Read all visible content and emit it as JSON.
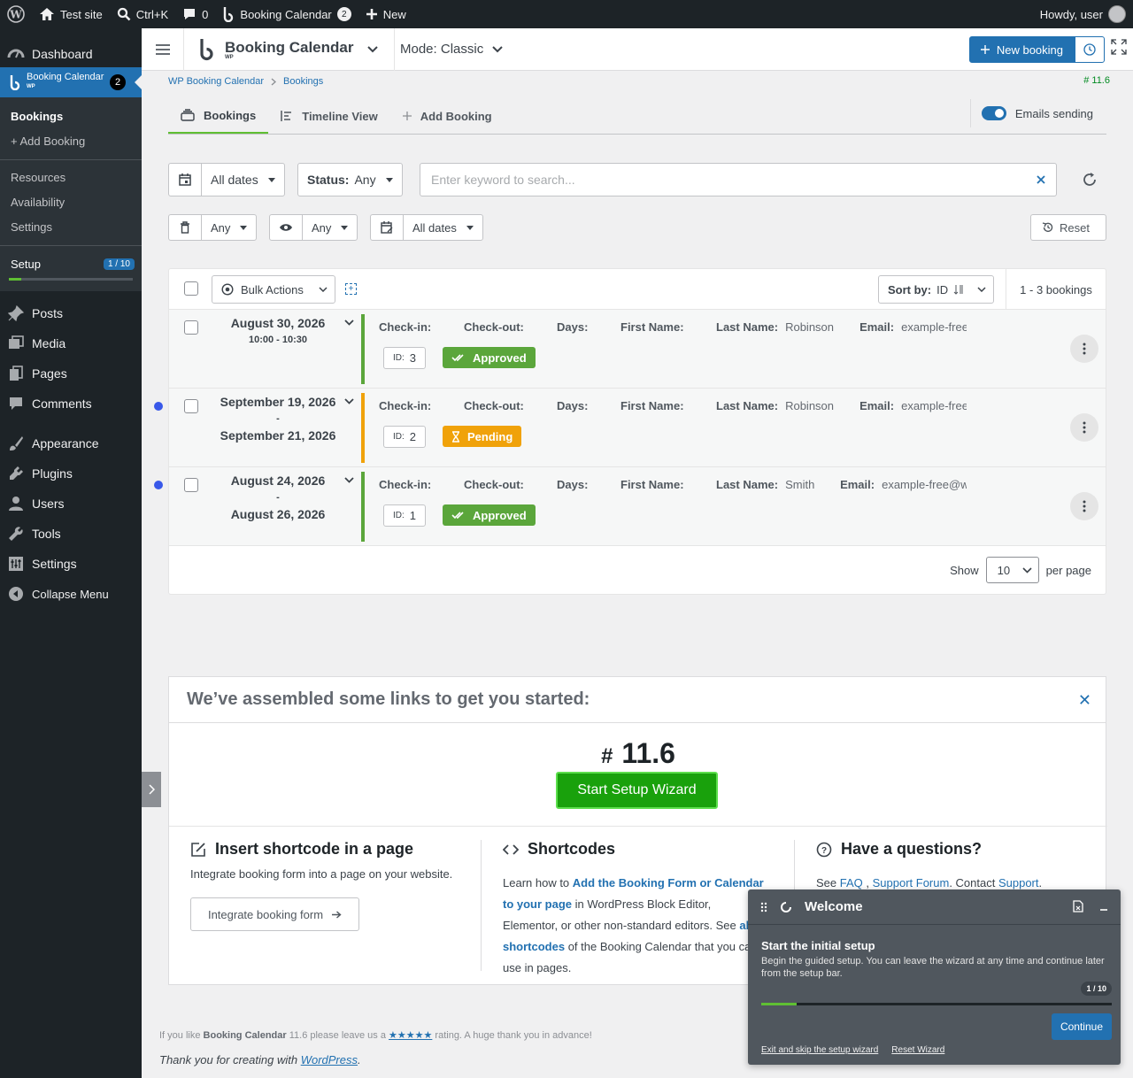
{
  "adminbar": {
    "site": "Test site",
    "search": "Ctrl+K",
    "comments": "0",
    "plugin": "Booking Calendar",
    "plugin_count": "2",
    "new": "New",
    "howdy": "Howdy, user"
  },
  "sidebar": {
    "dashboard": "Dashboard",
    "booking_calendar": "Booking Calendar",
    "booking_calendar_sub": "WP",
    "booking_count": "2",
    "sub": {
      "bookings": "Bookings",
      "add_booking": "+ Add Booking",
      "resources": "Resources",
      "availability": "Availability",
      "settings": "Settings",
      "setup": "Setup",
      "setup_step": "1 / 10",
      "setup_progress": 0.1
    },
    "items": {
      "posts": "Posts",
      "media": "Media",
      "pages": "Pages",
      "comments": "Comments",
      "appearance": "Appearance",
      "plugins": "Plugins",
      "users": "Users",
      "tools": "Tools",
      "settings": "Settings",
      "collapse": "Collapse Menu"
    }
  },
  "topbar": {
    "brand": "Booking Calendar",
    "brand_sub": "WP",
    "mode": "Mode: Classic",
    "new_booking": "New booking"
  },
  "breadcrumb": {
    "root": "WP Booking Calendar",
    "current": "Bookings",
    "version": "# 11.6"
  },
  "tabs": {
    "bookings": "Bookings",
    "timeline": "Timeline View",
    "add": "Add Booking",
    "emails": "Emails sending"
  },
  "filters": {
    "dates": "All dates",
    "status_label": "Status:",
    "status_value": "Any",
    "search_placeholder": "Enter keyword to search...",
    "trash_value": "Any",
    "read_value": "Any",
    "created_dates": "All dates",
    "reset": "Reset"
  },
  "list": {
    "bulk": "Bulk Actions",
    "sort_label": "Sort by:",
    "sort_value": "ID",
    "count": "1 - 3 bookings",
    "labels": {
      "checkin": "Check-in:",
      "checkout": "Check-out:",
      "days": "Days:",
      "first": "First Name:",
      "last": "Last Name:",
      "email": "Email:",
      "id": "ID:"
    },
    "rows": [
      {
        "date1": "August 30, 2026",
        "sep": "",
        "date2": "10:00 - 10:30",
        "last": "Robinson",
        "email": "example-free",
        "id": "3",
        "status": "Approved"
      },
      {
        "date1": "September 19, 2026",
        "sep": "-",
        "date2": "September 21, 2026",
        "last": "Robinson",
        "email": "example-free",
        "id": "2",
        "status": "Pending"
      },
      {
        "date1": "August 24, 2026",
        "sep": "-",
        "date2": "August 26, 2026",
        "last": "Smith",
        "email": "example-free@w",
        "id": "1",
        "status": "Approved"
      }
    ],
    "show": "Show",
    "per_page_value": "10",
    "per_page": "per page"
  },
  "colors": {
    "approved": "#5ba63b",
    "pending": "#f0a20a",
    "accent": "#2271b1"
  },
  "links": {
    "title": "We’ve assembled some links to get you started:",
    "hash": "#",
    "version": "11.6",
    "wizard_btn": "Start Setup Wizard",
    "insert_title": "Insert shortcode in a page",
    "insert_text": "Integrate booking form into a page on your website.",
    "insert_btn": "Integrate booking form",
    "short_title": "Shortcodes",
    "short_t1": "Learn how to ",
    "short_link1": "Add the Booking Form or Calendar to your page",
    "short_t2": " in WordPress Block Editor, Elementor, or other non-standard editors. See ",
    "short_link2": "all shortcodes",
    "short_t3": " of the Booking Calendar that you can use in pages.",
    "q_title": "Have a questions?",
    "q_see": "See ",
    "q_faq": "FAQ",
    "q_forum": "Support Forum",
    "q_contact": "Contact ",
    "q_support": "Support"
  },
  "footer": {
    "t1": "If you like ",
    "brand": "Booking Calendar",
    "t2": " 11.6 please leave us a ",
    "stars": "★★★★★",
    "t3": " rating. A huge thank you in advance!",
    "thanks": "Thank you for creating with ",
    "wp": "WordPress",
    "dot": "."
  },
  "welcome": {
    "title": "Welcome",
    "heading": "Start the initial setup",
    "desc": "Begin the guided setup. You can leave the wizard at any time and continue later from the setup bar.",
    "step": "1 / 10",
    "progress": 0.1,
    "continue": "Continue",
    "exit": "Exit and skip the setup wizard",
    "reset": "Reset Wizard"
  }
}
